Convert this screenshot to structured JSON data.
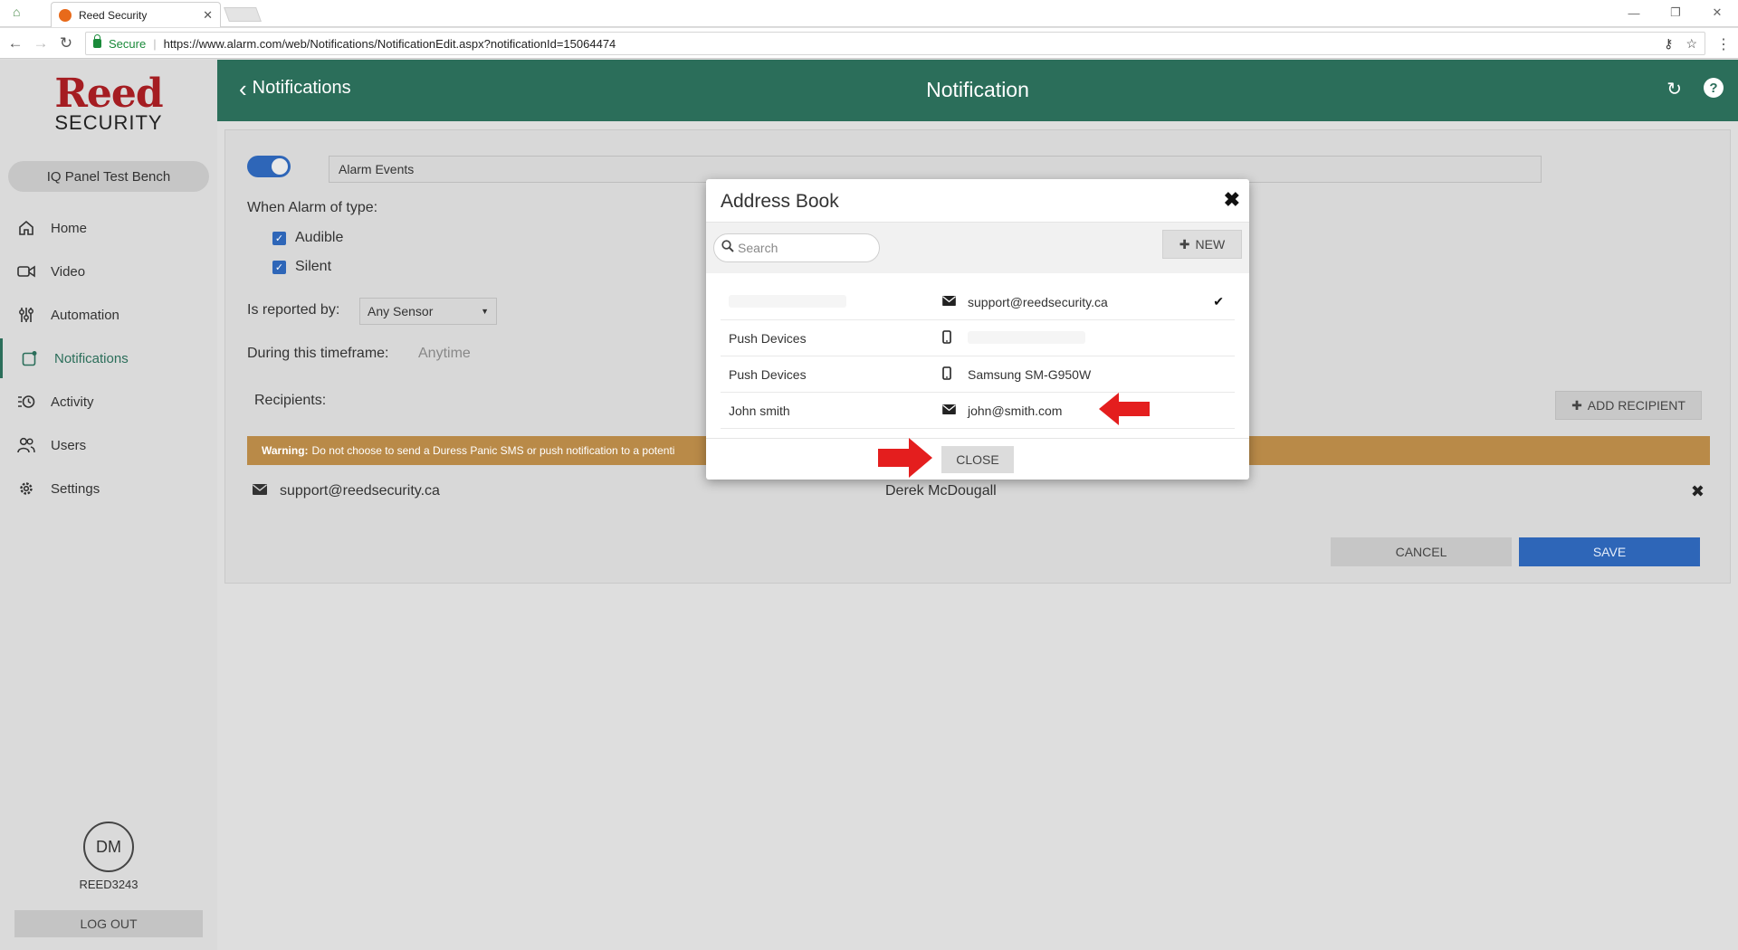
{
  "browser": {
    "tab_title": "Reed Security",
    "secure_label": "Secure",
    "url": "https://www.alarm.com/web/Notifications/NotificationEdit.aspx?notificationId=15064474"
  },
  "brand": {
    "reed": "Reed",
    "security": "SECURITY",
    "colors": {
      "primary": "#2b6e5a",
      "logo_red": "#a51d22",
      "accent_blue": "#2e66b8",
      "warning": "#b98a48"
    }
  },
  "panel_name": "IQ Panel Test Bench",
  "nav": [
    {
      "label": "Home",
      "icon": "home-icon"
    },
    {
      "label": "Video",
      "icon": "video-icon"
    },
    {
      "label": "Automation",
      "icon": "automation-icon"
    },
    {
      "label": "Notifications",
      "icon": "notifications-icon",
      "active": true
    },
    {
      "label": "Activity",
      "icon": "activity-icon"
    },
    {
      "label": "Users",
      "icon": "users-icon"
    },
    {
      "label": "Settings",
      "icon": "settings-icon"
    }
  ],
  "user": {
    "initials": "DM",
    "username": "REED3243",
    "logout_label": "LOG OUT"
  },
  "header": {
    "back_label": "Notifications",
    "title": "Notification"
  },
  "form": {
    "enabled": true,
    "name": "Alarm Events",
    "alarm_type_label": "When Alarm of type:",
    "audible_label": "Audible",
    "silent_label": "Silent",
    "reported_by_label": "Is reported by:",
    "reported_by_value": "Any Sensor",
    "timeframe_label": "During this timeframe:",
    "timeframe_value": "Anytime",
    "recipients_label": "Recipients:",
    "add_recipient_label": "ADD RECIPIENT",
    "warning_bold": "Warning:",
    "warning_text": "Do not choose to send a Duress Panic SMS or push notification to a potenti",
    "recipient": {
      "email": "support@reedsecurity.ca",
      "name": "Derek McDougall"
    },
    "cancel_label": "CANCEL",
    "save_label": "SAVE"
  },
  "modal": {
    "title": "Address Book",
    "search_placeholder": "Search",
    "new_label": "NEW",
    "rows": [
      {
        "name": "",
        "type_icon": "envelope-icon",
        "contact": "support@reedsecurity.ca",
        "selected": true
      },
      {
        "name": "Push Devices",
        "type_icon": "phone-icon",
        "contact": "",
        "selected": false
      },
      {
        "name": "Push Devices",
        "type_icon": "phone-icon",
        "contact": "Samsung SM-G950W",
        "selected": false
      },
      {
        "name": "John smith",
        "type_icon": "envelope-icon",
        "contact": "john@smith.com",
        "selected": false
      }
    ],
    "close_label": "CLOSE"
  }
}
